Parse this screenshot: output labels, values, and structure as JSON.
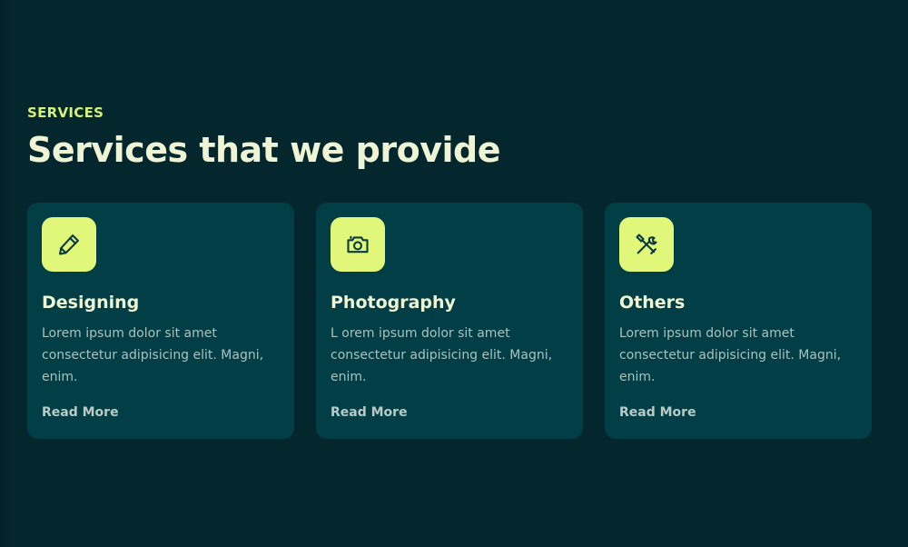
{
  "section": {
    "eyebrow": "SERVICES",
    "heading": "Services that we provide"
  },
  "cards": [
    {
      "icon": "pen-icon",
      "title": "Designing",
      "text": "Lorem ipsum dolor sit amet consectetur adipisicing elit. Magni, enim.",
      "link": "Read More"
    },
    {
      "icon": "camera-icon",
      "title": "Photography",
      "text": "L orem ipsum dolor sit amet consectetur adipisicing elit. Magni, enim.",
      "link": "Read More"
    },
    {
      "icon": "tools-icon",
      "title": "Others",
      "text": "Lorem ipsum dolor sit amet consectetur adipisicing elit. Magni, enim.",
      "link": "Read More"
    }
  ],
  "colors": {
    "background": "#04272e",
    "card": "#023e46",
    "accent": "#e0f77a",
    "heading": "#eef4d4",
    "body_text": "#a9c2c0"
  }
}
